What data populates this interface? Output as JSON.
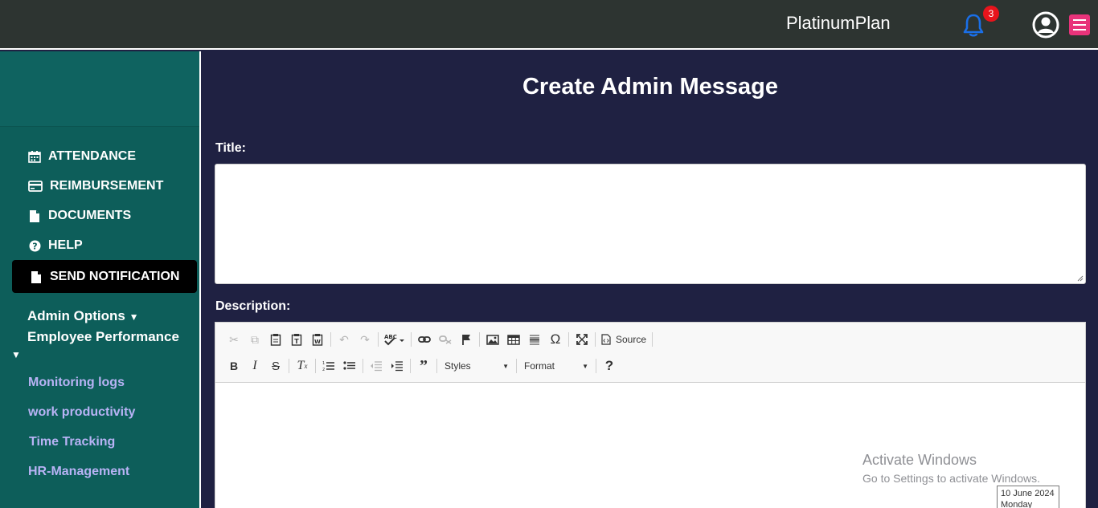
{
  "header": {
    "brand": "PlatinumPlan",
    "notification_count": "3"
  },
  "sidebar": {
    "items": [
      {
        "label": "ATTENDANCE",
        "icon": "calendar-icon"
      },
      {
        "label": "REIMBURSEMENT",
        "icon": "credit-card-icon"
      },
      {
        "label": "DOCUMENTS",
        "icon": "file-icon"
      },
      {
        "label": "HELP",
        "icon": "question-circle-icon"
      },
      {
        "label": "SEND NOTIFICATION",
        "icon": "file-icon",
        "active": true
      }
    ],
    "admin_options": "Admin Options",
    "employee_performance": "Employee Performance",
    "sub_links": [
      "Monitoring logs",
      "work productivity",
      "Time Tracking",
      "HR-Management"
    ]
  },
  "main": {
    "title": "Create Admin Message",
    "title_label": "Title:",
    "description_label": "Description:"
  },
  "editor": {
    "source_label": "Source",
    "styles_label": "Styles",
    "format_label": "Format"
  },
  "overlay": {
    "activate_title": "Activate Windows",
    "activate_sub": "Go to Settings to activate Windows.",
    "date": "10 June 2024",
    "day": "Monday"
  },
  "colors": {
    "topbar": "#2d3431",
    "sidebar": "#0d5e5a",
    "main_bg": "#1f2142",
    "bell": "#1a6fe8",
    "badge": "#e8141c",
    "menu_button": "#e8337a",
    "sub_link": "#b8b3f5"
  }
}
